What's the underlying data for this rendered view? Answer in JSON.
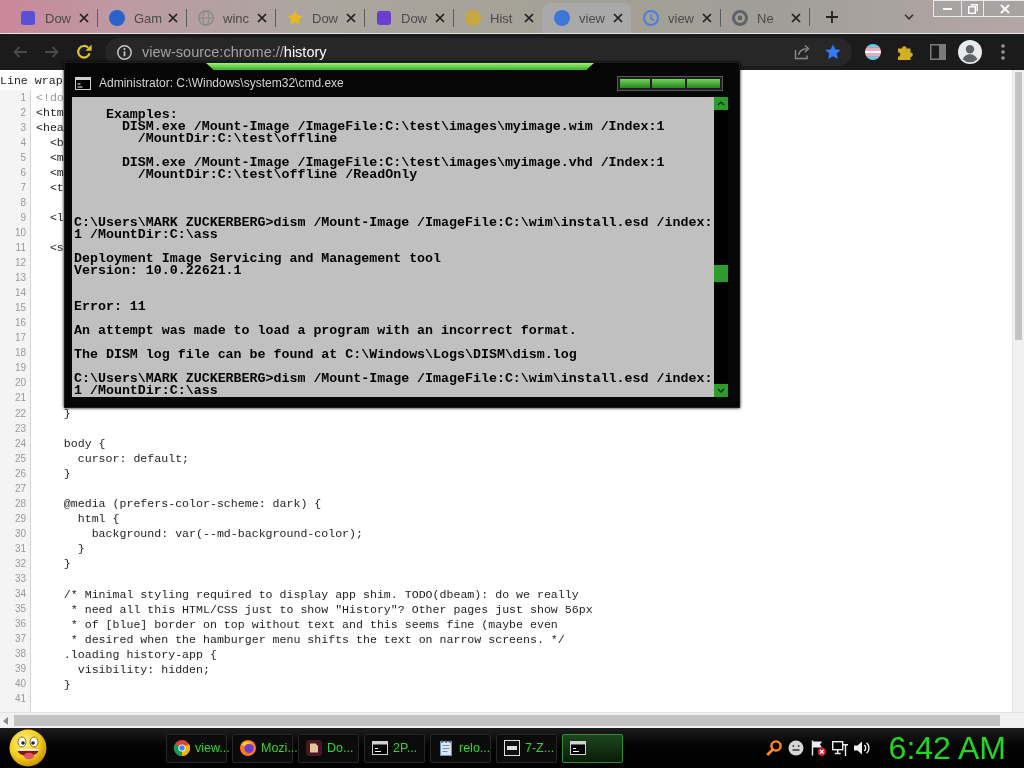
{
  "browser": {
    "tabs": [
      {
        "title": "Dow",
        "kind": "square",
        "color": "#5a4fd8",
        "selected": false
      },
      {
        "title": "Gam",
        "kind": "circle",
        "color": "#2a62c9",
        "selected": false
      },
      {
        "title": "winc",
        "kind": "globe",
        "color": "#8a8a8a",
        "selected": false
      },
      {
        "title": "Dow",
        "kind": "star",
        "color": "#e8b820",
        "selected": false
      },
      {
        "title": "Dow",
        "kind": "square",
        "color": "#6a3fd0",
        "selected": false
      },
      {
        "title": "Hist",
        "kind": "circle",
        "color": "#c8a640",
        "selected": false
      },
      {
        "title": "view",
        "kind": "circle",
        "color": "#3b78d8",
        "selected": true
      },
      {
        "title": "view",
        "kind": "clock",
        "color": "#4a7fe0",
        "selected": false
      },
      {
        "title": "Ne",
        "kind": "ring",
        "color": "#5f6368",
        "selected": false
      }
    ],
    "toolbar": {
      "nav": [
        {
          "kind": "back",
          "disabled": true
        },
        {
          "kind": "forward",
          "disabled": true
        },
        {
          "kind": "reload",
          "disabled": false
        }
      ],
      "address": {
        "scheme": "view-source:chrome://",
        "page": "history",
        "bookmarked": true
      }
    },
    "page": {
      "line_wrap_label": "Line wrap",
      "lines": [
        {
          "number": "1",
          "kind": "doctype",
          "text": "<!do"
        },
        {
          "number": "2",
          "kind": "code",
          "text": "<htm"
        },
        {
          "number": "3",
          "kind": "code",
          "text": "<hea"
        },
        {
          "number": "4",
          "kind": "code",
          "text": "  <b"
        },
        {
          "number": "5",
          "kind": "code",
          "text": "  <m"
        },
        {
          "number": "6",
          "kind": "code",
          "text": "  <m"
        },
        {
          "number": "7",
          "kind": "code",
          "text": "  <t"
        },
        {
          "number": "8"
        },
        {
          "number": "9",
          "kind": "code",
          "text": "  <l"
        },
        {
          "number": "10"
        },
        {
          "number": "11",
          "kind": "code",
          "text": "  <s"
        },
        {
          "number": "12"
        },
        {
          "number": "13"
        },
        {
          "number": "14"
        },
        {
          "number": "15"
        },
        {
          "number": "16"
        },
        {
          "number": "17"
        },
        {
          "number": "18"
        },
        {
          "number": "19"
        },
        {
          "number": "20"
        },
        {
          "number": "21"
        },
        {
          "number": "22",
          "kind": "code",
          "text": "    }"
        },
        {
          "number": "23"
        },
        {
          "number": "24",
          "kind": "code",
          "text": "    body {"
        },
        {
          "number": "25",
          "kind": "code",
          "text": "      cursor: default;"
        },
        {
          "number": "26",
          "kind": "code",
          "text": "    }"
        },
        {
          "number": "27"
        },
        {
          "number": "28",
          "kind": "code",
          "text": "    @media (prefers-color-scheme: dark) {"
        },
        {
          "number": "29",
          "kind": "code",
          "text": "      html {"
        },
        {
          "number": "30",
          "kind": "code",
          "text": "        background: var(--md-background-color);"
        },
        {
          "number": "31",
          "kind": "code",
          "text": "      }"
        },
        {
          "number": "32",
          "kind": "code",
          "text": "    }"
        },
        {
          "number": "33"
        },
        {
          "number": "34",
          "kind": "code",
          "text": "    /* Minimal styling required to display app shim. TODO(dbeam): do we really"
        },
        {
          "number": "35",
          "kind": "code",
          "text": "     * need all this HTML/CSS just to show \"History\"? Other pages just show 56px"
        },
        {
          "number": "36",
          "kind": "code",
          "text": "     * of [blue] border on top without text and this seems fine (maybe even"
        },
        {
          "number": "37",
          "kind": "code",
          "text": "     * desired when the hamburger menu shifts the text on narrow screens. */"
        },
        {
          "number": "38",
          "kind": "code",
          "text": "    .loading history-app {"
        },
        {
          "number": "39",
          "kind": "code",
          "text": "      visibility: hidden;"
        },
        {
          "number": "40",
          "kind": "code",
          "text": "    }"
        },
        {
          "number": "41"
        }
      ]
    }
  },
  "console_window": {
    "title": "Administrator: C:\\Windows\\system32\\cmd.exe",
    "output": "    Examples:\n      DISM.exe /Mount-Image /ImageFile:C:\\test\\images\\myimage.wim /Index:1\n        /MountDir:C:\\test\\offline\n\n      DISM.exe /Mount-Image /ImageFile:C:\\test\\images\\myimage.vhd /Index:1\n        /MountDir:C:\\test\\offline /ReadOnly\n\n\n\nC:\\Users\\MARK ZUCKERBERG>dism /Mount-Image /ImageFile:C:\\wim\\install.esd /index:\n1 /MountDir:C:\\ass\n\nDeployment Image Servicing and Management tool\nVersion: 10.0.22621.1\n\n\nError: 11\n\nAn attempt was made to load a program with an incorrect format.\n\nThe DISM log file can be found at C:\\Windows\\Logs\\DISM\\dism.log\n\nC:\\Users\\MARK ZUCKERBERG>dism /Mount-Image /ImageFile:C:\\wim\\install.esd /index:\n1 /MountDir:C:\\ass"
  },
  "taskbar": {
    "buttons": [
      {
        "label": "view...",
        "kind": "ring-logo",
        "selected": false
      },
      {
        "label": "Mozi...",
        "kind": "fox",
        "selected": false
      },
      {
        "label": "Do...",
        "kind": "app",
        "selected": false
      },
      {
        "label": "2P...",
        "kind": "console",
        "selected": false
      },
      {
        "label": "relo...",
        "kind": "notepad",
        "selected": false
      },
      {
        "label": "7-Z...",
        "kind": "archive",
        "selected": false
      },
      {
        "kind": "console",
        "selected": true
      }
    ],
    "clock": "6:42 AM"
  }
}
